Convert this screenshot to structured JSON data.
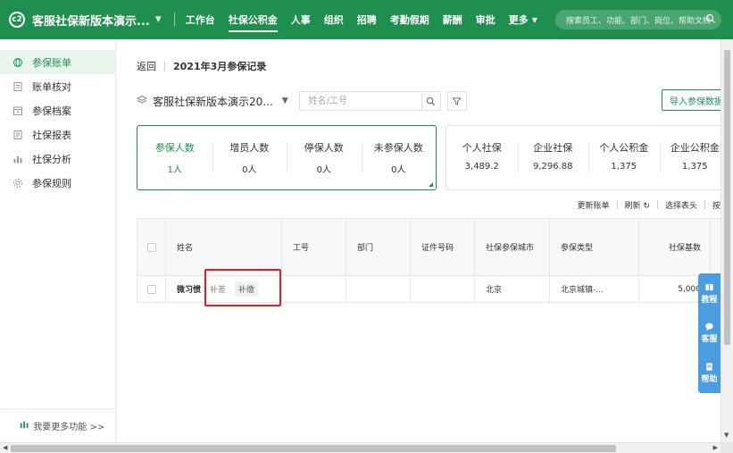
{
  "header": {
    "logo_text": "c2",
    "app_title": "客服社保新版本演示...",
    "nav": [
      {
        "label": "工作台",
        "active": false
      },
      {
        "label": "社保公积金",
        "active": true
      },
      {
        "label": "人事",
        "active": false
      },
      {
        "label": "组织",
        "active": false
      },
      {
        "label": "招聘",
        "active": false
      },
      {
        "label": "考勤假期",
        "active": false
      },
      {
        "label": "薪酬",
        "active": false
      },
      {
        "label": "审批",
        "active": false
      },
      {
        "label": "更多",
        "active": false
      }
    ],
    "search_placeholder": "搜索员工、功能、部门、岗位、帮助文档"
  },
  "sidebar": {
    "items": [
      {
        "label": "参保账单",
        "icon": "globe-icon",
        "active": true
      },
      {
        "label": "账单核对",
        "icon": "document-icon",
        "active": false
      },
      {
        "label": "参保档案",
        "icon": "archive-icon",
        "active": false
      },
      {
        "label": "社保报表",
        "icon": "report-icon",
        "active": false
      },
      {
        "label": "社保分析",
        "icon": "bar-chart-icon",
        "active": false
      },
      {
        "label": "参保规则",
        "icon": "gear-icon",
        "active": false
      }
    ],
    "more_features": "我要更多功能 >>"
  },
  "breadcrumb": {
    "back": "返回",
    "title": "2021年3月参保记录"
  },
  "filter": {
    "company": "客服社保新版本演示20...",
    "name_placeholder": "姓名/工号",
    "import_label": "导入参保数据"
  },
  "stats_left": [
    {
      "label": "参保人数",
      "value": "1人",
      "active": true
    },
    {
      "label": "增员人数",
      "value": "0人",
      "active": false
    },
    {
      "label": "停保人数",
      "value": "0人",
      "active": false
    },
    {
      "label": "未参保人数",
      "value": "0人",
      "active": false
    }
  ],
  "stats_right": [
    {
      "label": "个人社保",
      "value": "3,489.2"
    },
    {
      "label": "企业社保",
      "value": "9,296.88"
    },
    {
      "label": "个人公积金",
      "value": "1,375"
    },
    {
      "label": "企业公积金",
      "value": "1,375"
    }
  ],
  "actions": {
    "update_bill": "更新账单",
    "refresh": "刷新 ↻",
    "choose_columns": "选择表头",
    "more": "按"
  },
  "table": {
    "headers": [
      "姓名",
      "工号",
      "部门",
      "证件号码",
      "社保参保城市",
      "参保类型",
      "社保基数"
    ],
    "rows": [
      {
        "name": "微习惯",
        "tags": [
          "补差",
          "补缴"
        ],
        "emp_no": "",
        "dept": "",
        "id_no": "",
        "city": "北京",
        "type": "北京城镇-...",
        "base": "5,000"
      }
    ]
  },
  "help_float": {
    "tutorial": "教程",
    "service": "客服",
    "help": "帮助"
  },
  "colors": {
    "brand": "#1f8f4f",
    "float_blue": "#4a9de0",
    "highlight_red": "#e02020"
  }
}
